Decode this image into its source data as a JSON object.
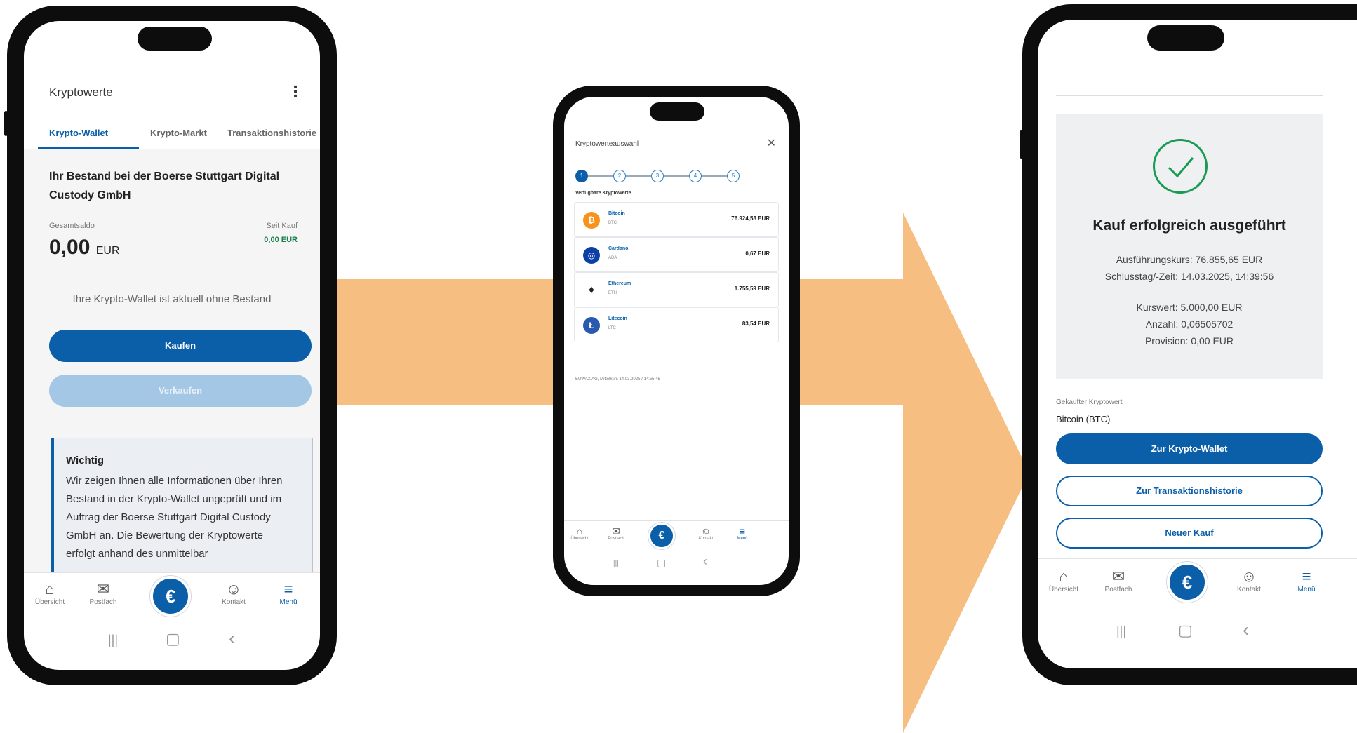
{
  "phone1": {
    "header_title": "Kryptowerte",
    "menu_glyph": "⋮",
    "tabs": [
      "Krypto-Wallet",
      "Krypto-Markt",
      "Transaktionshistorie"
    ],
    "active_tab": "Krypto-Wallet",
    "bestand_title": "Ihr Bestand bei der Boerse Stuttgart Digital Custody GmbH",
    "gesamtsaldo_label": "Gesamtsaldo",
    "gesamtsaldo_value": "0,00",
    "gesamtsaldo_unit": "EUR",
    "seit_kauf_label": "Seit Kauf",
    "seit_kauf_value": "0,00 EUR",
    "empty_message": "Ihre Krypto-Wallet ist aktuell ohne Bestand",
    "buy_button": "Kaufen",
    "sell_button": "Verkaufen",
    "info_title": "Wichtig",
    "info_text": "Wir zeigen Ihnen alle Informationen über Ihren Bestand in der Krypto-Wallet ungeprüft und im Auftrag der Boerse Stuttgart Digital Custody GmbH an. Die Bewertung der Kryptowerte erfolgt anhand des unmittelbar"
  },
  "phone2": {
    "header_title": "Kryptowerteauswahl",
    "close_glyph": "✕",
    "steps": [
      "1",
      "2",
      "3",
      "4",
      "5"
    ],
    "active_step": "1",
    "section_title": "Verfügbare Kryptowerte",
    "coins": [
      {
        "name": "Bitcoin",
        "symbol": "BTC",
        "value": "76.924,53 EUR",
        "color": "#f7931a",
        "glyph": "₿"
      },
      {
        "name": "Cardano",
        "symbol": "ADA",
        "value": "0,67 EUR",
        "color": "#0d3fa8",
        "glyph": "◎"
      },
      {
        "name": "Ethereum",
        "symbol": "ETH",
        "value": "1.755,59 EUR",
        "color": "#ffffff",
        "glyph": "♦"
      },
      {
        "name": "Litecoin",
        "symbol": "LTC",
        "value": "83,54 EUR",
        "color": "#2a5ab0",
        "glyph": "Ł"
      }
    ],
    "footer_note": "EUWAX AG, Mittelkurs 14.03.2025 / 14:55:45"
  },
  "phone3": {
    "success_title": "Kauf erfolgreich ausgeführt",
    "exec_rate": "Ausführungskurs: 76.855,65 EUR",
    "close_time": "Schlusstag/-Zeit: 14.03.2025, 14:39:56",
    "kurswert": "Kurswert: 5.000,00 EUR",
    "anzahl": "Anzahl: 0,06505702",
    "provision": "Provision: 0,00 EUR",
    "purchased_label": "Gekaufter Kryptowert",
    "purchased_value": "Bitcoin (BTC)",
    "btn_wallet": "Zur Krypto-Wallet",
    "btn_history": "Zur Transaktionshistorie",
    "btn_new": "Neuer Kauf"
  },
  "bottom_nav": {
    "items": [
      {
        "label": "Übersicht",
        "icon": "home-icon",
        "glyph": "⌂"
      },
      {
        "label": "Postfach",
        "icon": "mail-icon",
        "glyph": "✉"
      },
      {
        "label": "Kontakt",
        "icon": "contact-icon",
        "glyph": "☺"
      },
      {
        "label": "Menü",
        "icon": "menu-icon",
        "glyph": "≡"
      }
    ],
    "center_glyph": "€"
  },
  "system_bar": {
    "recent": "|||",
    "home": "▢",
    "back": "‹"
  },
  "colors": {
    "accent": "#0a5fa8",
    "arrow": "#f6be80",
    "success": "#1a9a52",
    "gain": "#1a7f4b"
  }
}
